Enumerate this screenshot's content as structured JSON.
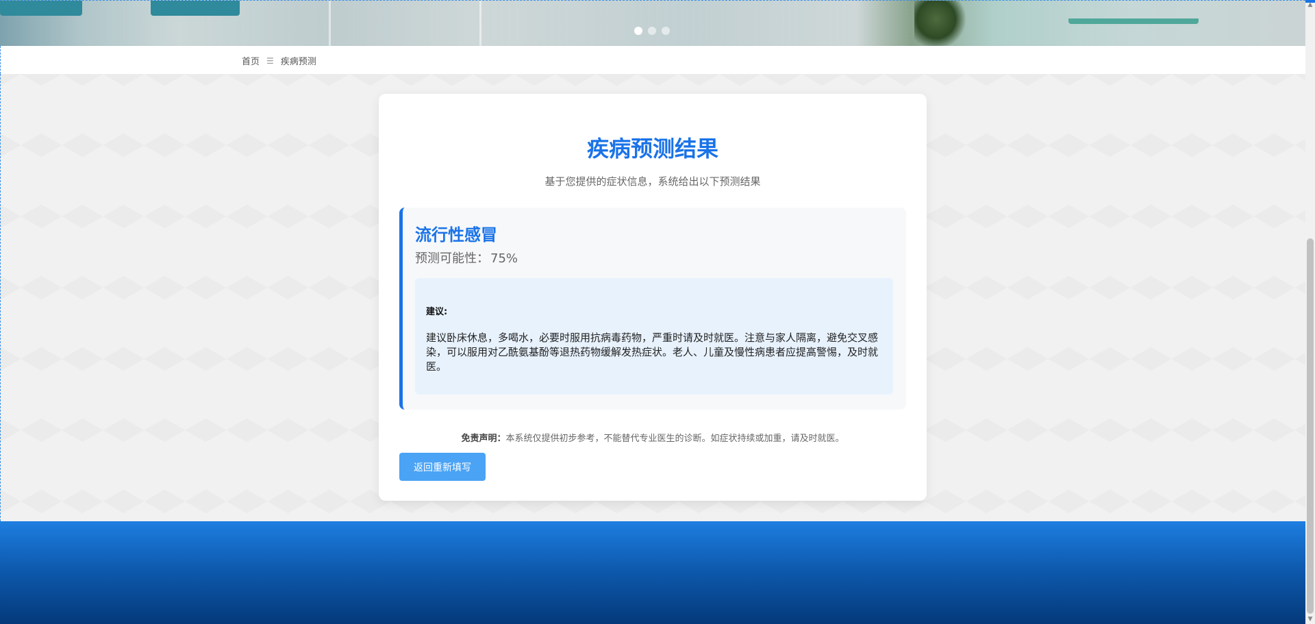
{
  "banner": {
    "slides": 3,
    "active_slide": 1
  },
  "breadcrumb": {
    "home": "首页",
    "separator": "☰",
    "current": "疾病预测"
  },
  "result_card": {
    "title": "疾病预测结果",
    "subtitle": "基于您提供的症状信息，系统给出以下预测结果",
    "disease": "流行性感冒",
    "probability_label": "预测可能性：",
    "probability_value": "75%",
    "advice_label": "建议:",
    "advice_text": "建议卧床休息，多喝水，必要时服用抗病毒药物，严重时请及时就医。注意与家人隔离，避免交叉感染，可以服用对乙酰氨基酚等退热药物缓解发热症状。老人、儿童及慢性病患者应提高警惕，及时就医。",
    "disclaimer_label": "免责声明：",
    "disclaimer_text": "本系统仅提供初步参考，不能替代专业医生的诊断。如症状持续或加重，请及时就医。",
    "back_button": "返回重新填写"
  },
  "colors": {
    "accent": "#1a73e8",
    "button": "#4aa3f5",
    "advice_bg": "#e8f2fd",
    "footer_top": "#1e7ee0",
    "footer_bottom": "#04397a"
  },
  "icons": {
    "breadcrumb_separator": "menu-icon",
    "scroll_up": "triangle-up-icon",
    "scroll_down": "triangle-down-icon"
  }
}
